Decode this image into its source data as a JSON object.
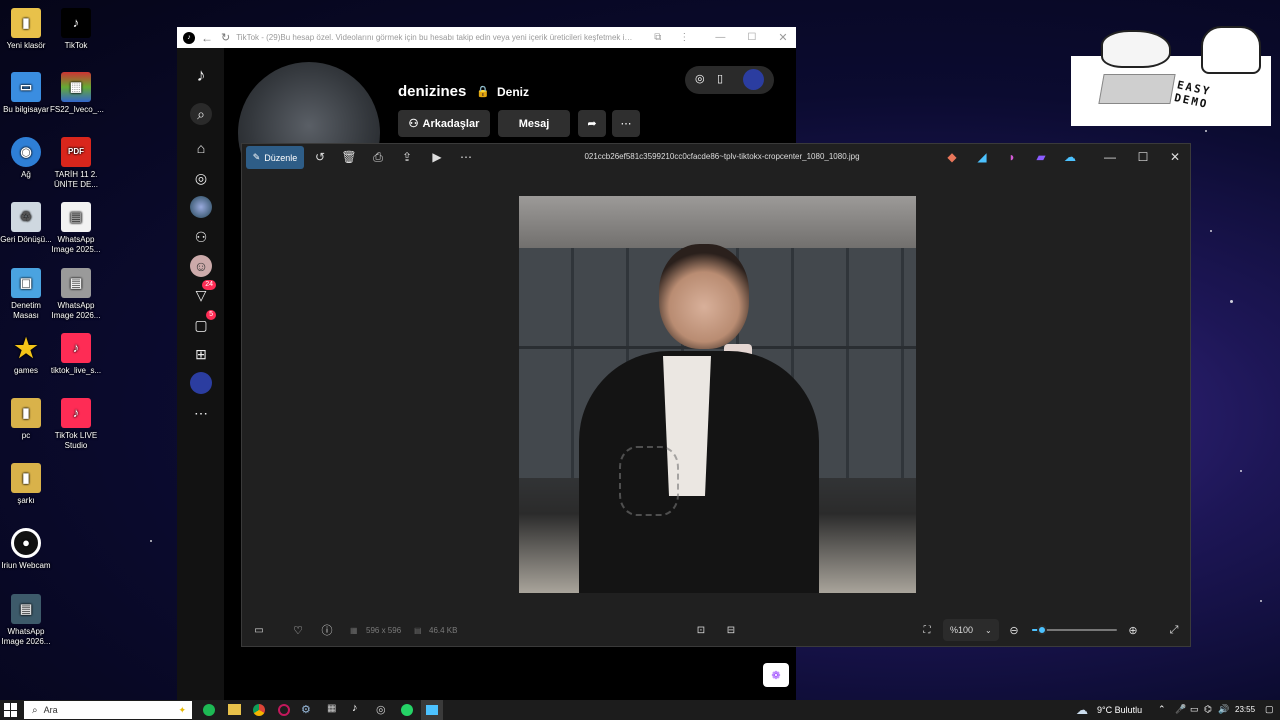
{
  "desktop": {
    "icons": [
      {
        "label": "Yeni klasör"
      },
      {
        "label": "TikTok"
      },
      {
        "label": "Bu bilgisayar"
      },
      {
        "label": "FS22_Iveco_..."
      },
      {
        "label": "Ağ"
      },
      {
        "label": "TARİH 11 2. ÜNİTE DE..."
      },
      {
        "label": "Geri Dönüşü..."
      },
      {
        "label": "WhatsApp Image 2025..."
      },
      {
        "label": "Denetim Masası"
      },
      {
        "label": "WhatsApp Image 2026..."
      },
      {
        "label": "games"
      },
      {
        "label": "tiktok_live_s..."
      },
      {
        "label": "pc"
      },
      {
        "label": "TikTok LIVE Studio"
      },
      {
        "label": "şarkı"
      },
      {
        "label": "Iriun Webcam"
      },
      {
        "label": "WhatsApp Image 2026..."
      }
    ],
    "pdf_badge": "PDF",
    "sticker_text": "EASY DEMO"
  },
  "tiktok": {
    "tab_title": "TikTok - (29)Bu hesap özel. Videolarını görmek için bu hesabı takip edin veya yeni içerik üreticileri keşfetmek için...",
    "username": "denizines",
    "nickname": "Deniz",
    "friends_label": "Arkadaşlar",
    "message_label": "Mesaj",
    "badge_inbox": "24",
    "badge_messages": "5"
  },
  "photos": {
    "edit_label": "Düzenle",
    "filename": "021ccb26ef581c3599210cc0cfacde86~tplv-tiktokx-cropcenter_1080_1080.jpg",
    "dimensions": "596 x 596",
    "filesize": "46.4 KB",
    "zoom": "%100",
    "zoom_level": 0.12
  },
  "taskbar": {
    "search_placeholder": "Ara",
    "weather": "9°C Bulutlu",
    "time": "23:55"
  },
  "colors": {
    "tiktok_pink": "#fe2c55",
    "photos_accent": "#4cc2ff",
    "desktop_bg": "#0b0b30"
  }
}
